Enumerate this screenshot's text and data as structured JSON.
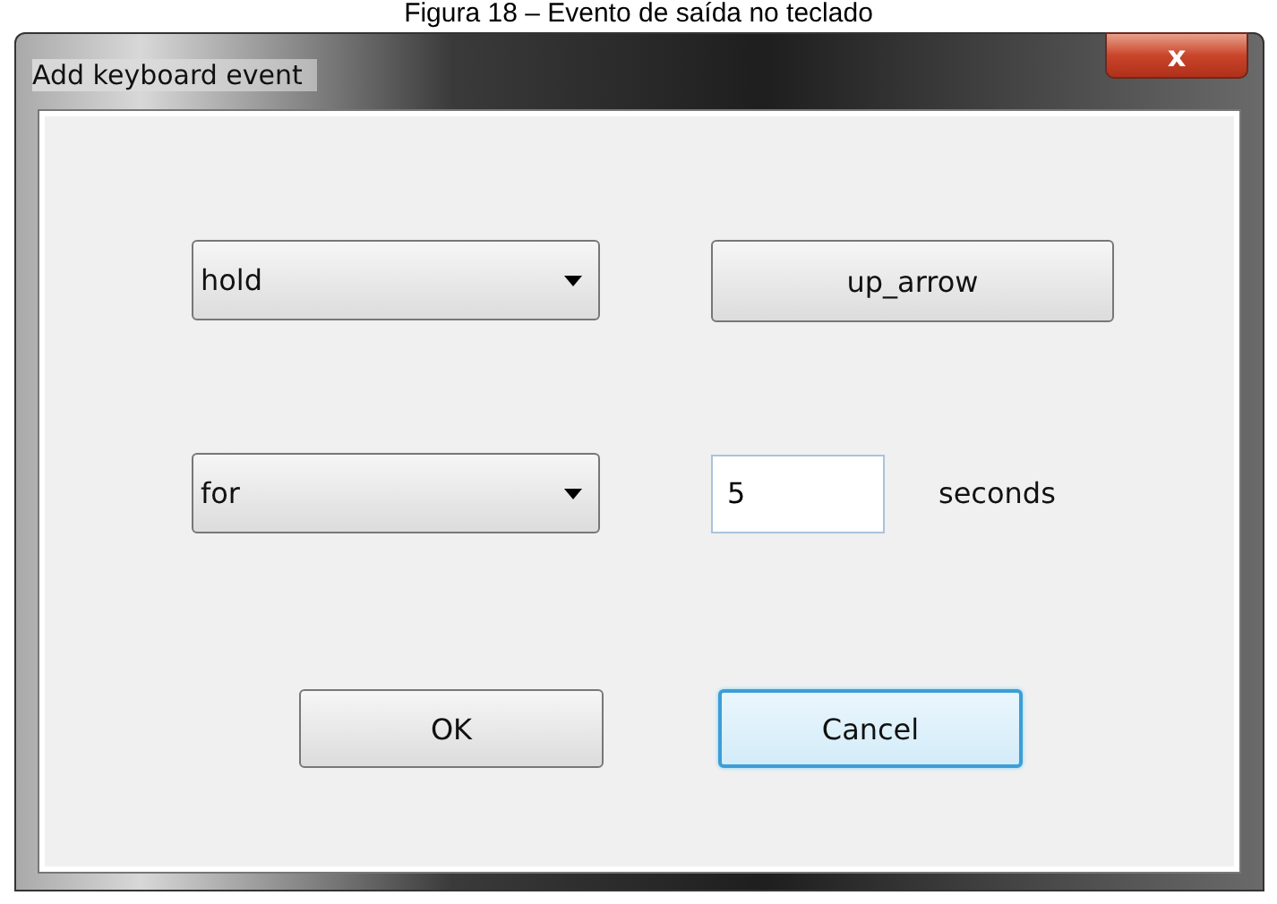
{
  "caption": "Figura 18 – Evento de saída no teclado",
  "window": {
    "title": "Add keyboard event",
    "close_label": "x"
  },
  "dropdowns": [
    {
      "value": "hold"
    },
    {
      "value": "for"
    }
  ],
  "key_button": {
    "label": "up_arrow"
  },
  "duration": {
    "value": "5",
    "unit": "seconds"
  },
  "buttons": [
    {
      "label": "OK",
      "focused": false
    },
    {
      "label": "Cancel",
      "focused": true
    }
  ]
}
